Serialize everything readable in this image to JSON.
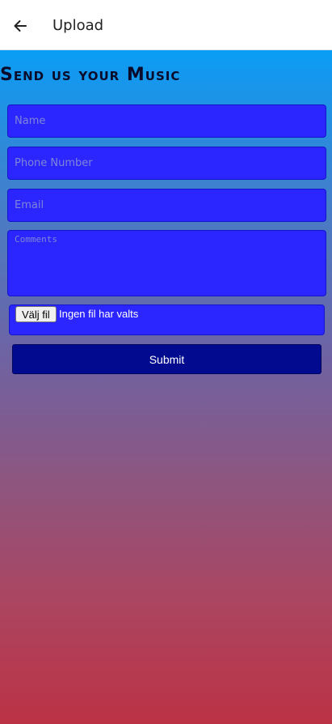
{
  "appbar": {
    "back_icon": "arrow-left-icon",
    "title": "Upload"
  },
  "form": {
    "heading": "Send us your Music",
    "name_placeholder": "Name",
    "phone_placeholder": "Phone Number",
    "email_placeholder": "Email",
    "comments_placeholder": "Comments",
    "file_button_label": "Välj fil",
    "file_status": "Ingen fil har valts",
    "submit_label": "Submit"
  },
  "colors": {
    "field_bg": "#2b25ff",
    "submit_bg": "#020a8f",
    "gradient_top": "#0a9df5",
    "gradient_bottom": "#bc3245"
  }
}
